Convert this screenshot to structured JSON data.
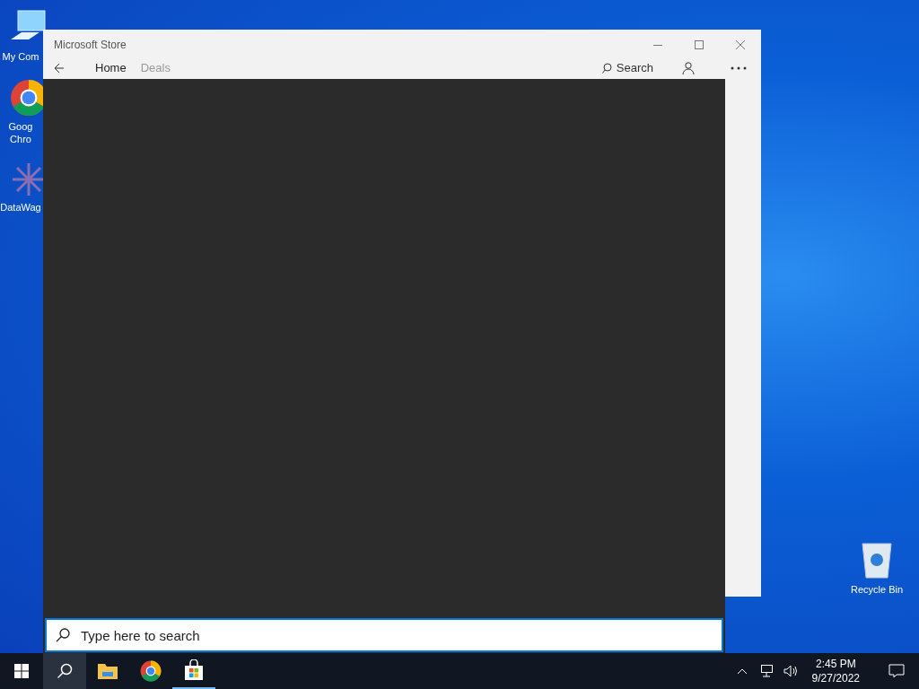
{
  "desktop_icons": [
    {
      "kind": "computer",
      "label": "My Com"
    },
    {
      "kind": "chrome",
      "label": "Goog Chro"
    },
    {
      "kind": "datawag",
      "label": "DataWag"
    },
    {
      "kind": "recycle",
      "label": "Recycle Bin"
    }
  ],
  "window": {
    "title": "Microsoft Store",
    "nav": [
      {
        "label": "Home",
        "selected": true
      },
      {
        "label": "Deals",
        "selected": false
      }
    ],
    "search_label": "Search"
  },
  "search_box": {
    "placeholder": "Type here to search"
  },
  "taskbar": {
    "items": [
      {
        "kind": "search",
        "selected": true
      },
      {
        "kind": "explorer",
        "selected": false
      },
      {
        "kind": "chrome",
        "selected": false
      },
      {
        "kind": "store",
        "selected": true
      }
    ],
    "time": "2:45 PM",
    "date": "9/27/2022"
  }
}
